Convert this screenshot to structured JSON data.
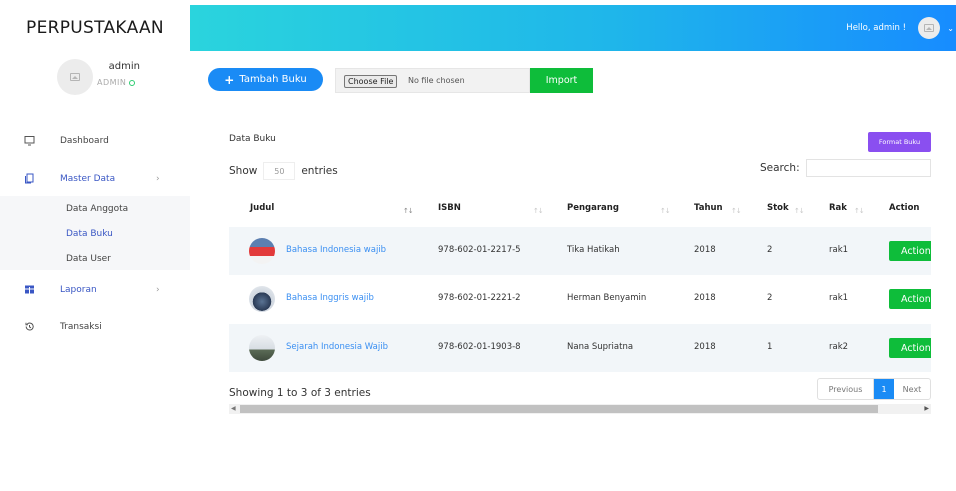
{
  "app": {
    "brand": "PERPUSTAKAAN"
  },
  "user": {
    "name": "admin",
    "role": "ADMIN"
  },
  "header": {
    "greeting": "Hello, admin !"
  },
  "sidebar": {
    "dashboard": "Dashboard",
    "master_data": "Master Data",
    "submenu": [
      "Data Anggota",
      "Data Buku",
      "Data User"
    ],
    "laporan": "Laporan",
    "transaksi": "Transaksi",
    "chevron": "›"
  },
  "toolbar": {
    "add_label": "Tambah Buku",
    "file_button": "Choose File",
    "file_status": "No file chosen",
    "import_label": "Import"
  },
  "card": {
    "title": "Data Buku",
    "format_label": "Format Buku",
    "show_label": "Show",
    "entries_label": "entries",
    "length_value": "50",
    "search_label": "Search:"
  },
  "table": {
    "headers": [
      "Judul",
      "ISBN",
      "Pengarang",
      "Tahun",
      "Stok",
      "Rak",
      "Action"
    ],
    "rows": [
      {
        "judul": "Bahasa Indonesia wajib",
        "isbn": "978-602-01-2217-5",
        "pengarang": "Tika Hatikah",
        "tahun": "2018",
        "stok": "2",
        "rak": "rak1",
        "action": "Action"
      },
      {
        "judul": "Bahasa Inggris wajib",
        "isbn": "978-602-01-2221-2",
        "pengarang": "Herman Benyamin",
        "tahun": "2018",
        "stok": "2",
        "rak": "rak1",
        "action": "Action"
      },
      {
        "judul": "Sejarah Indonesia Wajib",
        "isbn": "978-602-01-1903-8",
        "pengarang": "Nana Supriatna",
        "tahun": "2018",
        "stok": "1",
        "rak": "rak2",
        "action": "Action"
      }
    ]
  },
  "footer": {
    "info": "Showing 1 to 3 of 3 entries",
    "previous": "Previous",
    "current_page": "1",
    "next": "Next"
  },
  "colors": {
    "accent": "#1a8bf5",
    "success": "#0ebd3a",
    "format": "#8a4ff0",
    "link": "#3a8ff2"
  }
}
